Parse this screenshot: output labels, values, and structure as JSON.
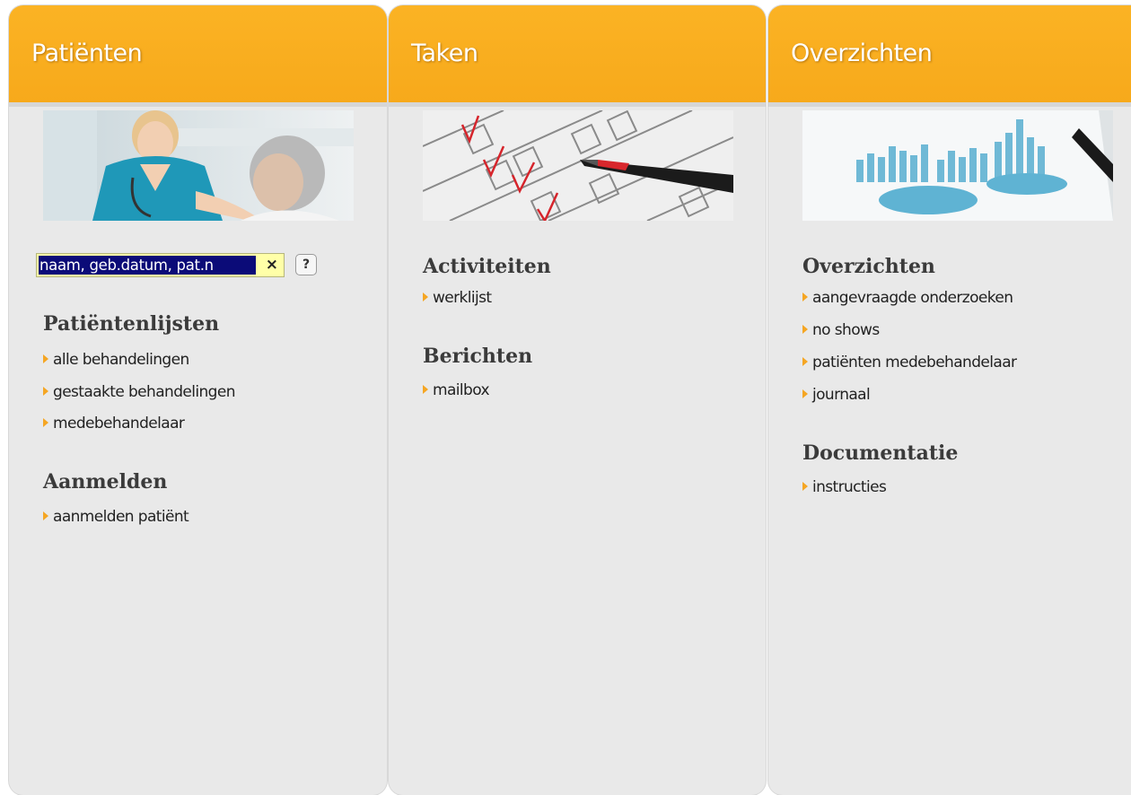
{
  "panels": {
    "patienten": {
      "title": "Patiënten",
      "search": {
        "value": "naam, geb.datum, pat.n",
        "clear": "×",
        "help": "?"
      },
      "sections": [
        {
          "title": "Patiëntenlijsten",
          "links": [
            "alle behandelingen",
            "gestaakte behandelingen",
            "medebehandelaar"
          ]
        },
        {
          "title": "Aanmelden",
          "links": [
            "aanmelden patiënt"
          ]
        }
      ]
    },
    "taken": {
      "title": "Taken",
      "sections": [
        {
          "title": "Activiteiten",
          "links": [
            "werklijst"
          ]
        },
        {
          "title": "Berichten",
          "links": [
            "mailbox"
          ]
        }
      ]
    },
    "overzichten": {
      "title": "Overzichten",
      "sections": [
        {
          "title": "Overzichten",
          "links": [
            "aangevraagde onderzoeken",
            "no shows",
            "patiënten medebehandelaar",
            "journaal"
          ]
        },
        {
          "title": "Documentatie",
          "links": [
            "instructies"
          ]
        }
      ]
    }
  },
  "colors": {
    "header": "#f7a91b",
    "panel_bg": "#e9e9e9",
    "arrow": "#f5a623",
    "selection": "#0b0b78",
    "search_bg": "#ffffa8"
  },
  "icons": [
    "bullet-arrow-icon",
    "clear-icon",
    "help-icon"
  ]
}
